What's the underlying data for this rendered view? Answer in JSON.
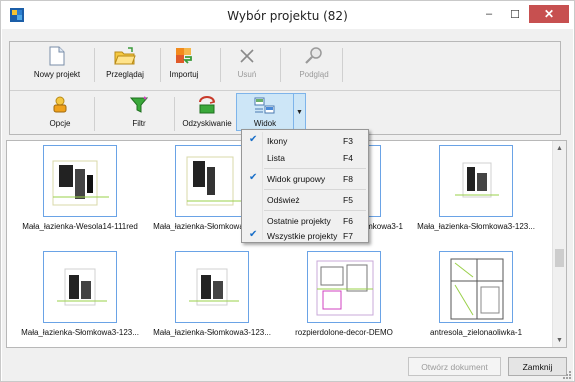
{
  "window": {
    "title": "Wybór projektu (82)",
    "minimize_glyph": "–",
    "maximize_glyph": "☐",
    "close_glyph": "✕"
  },
  "toolbar": {
    "row1": [
      {
        "id": "new",
        "label": "Nowy projekt",
        "icon": "new-document-icon",
        "enabled": true
      },
      {
        "id": "browse",
        "label": "Przeglądaj",
        "icon": "folder-open-icon",
        "enabled": true
      },
      {
        "id": "import",
        "label": "Importuj",
        "icon": "import-icon",
        "enabled": true
      },
      {
        "id": "delete",
        "label": "Usuń",
        "icon": "delete-x-icon",
        "enabled": false
      },
      {
        "id": "preview",
        "label": "Podgląd",
        "icon": "magnifier-icon",
        "enabled": false
      }
    ],
    "row2": [
      {
        "id": "options",
        "label": "Opcje",
        "icon": "options-icon",
        "enabled": true
      },
      {
        "id": "filter",
        "label": "Filtr",
        "icon": "filter-funnel-icon",
        "enabled": true
      },
      {
        "id": "recovery",
        "label": "Odzyskiwanie",
        "icon": "recovery-icon",
        "enabled": true
      },
      {
        "id": "view",
        "label": "Widok",
        "icon": "view-icon",
        "enabled": true
      }
    ],
    "dropdown_glyph": "▼"
  },
  "projects": [
    {
      "name": "Mała_łazienka-Wesola14-111red"
    },
    {
      "name": "Mała_łazienka-Słomkowa3-123..."
    },
    {
      "name": "Mała_łazienka-Słomkowa3-1"
    },
    {
      "name": "Mała_łazienka-Słomkowa3-123..."
    },
    {
      "name": "Mała_łazienka-Słomkowa3-123..."
    },
    {
      "name": "Mała_łazienka-Słomkowa3-123..."
    },
    {
      "name": "rozpierdolone-decor-DEMO"
    },
    {
      "name": "antresola_zielonaoliwka-1"
    }
  ],
  "view_menu": {
    "items": [
      {
        "label": "Ikony",
        "shortcut": "F3",
        "checked": true
      },
      {
        "label": "Lista",
        "shortcut": "F4",
        "checked": false
      },
      {
        "label": "Widok grupowy",
        "shortcut": "F8",
        "checked": true
      },
      {
        "label": "Odśwież",
        "shortcut": "F5",
        "checked": false
      },
      {
        "label": "Ostatnie projekty",
        "shortcut": "F6",
        "checked": false
      },
      {
        "label": "Wszystkie projekty",
        "shortcut": "F7",
        "checked": true
      }
    ],
    "check_glyph": "✔"
  },
  "footer": {
    "open_label": "Otwórz dokument",
    "close_label": "Zamknij"
  },
  "scrollbar": {
    "up_glyph": "▲",
    "down_glyph": "▼"
  },
  "colors": {
    "accent": "#7eb4ea",
    "selection": "#cde6f7",
    "close": "#c75050"
  }
}
